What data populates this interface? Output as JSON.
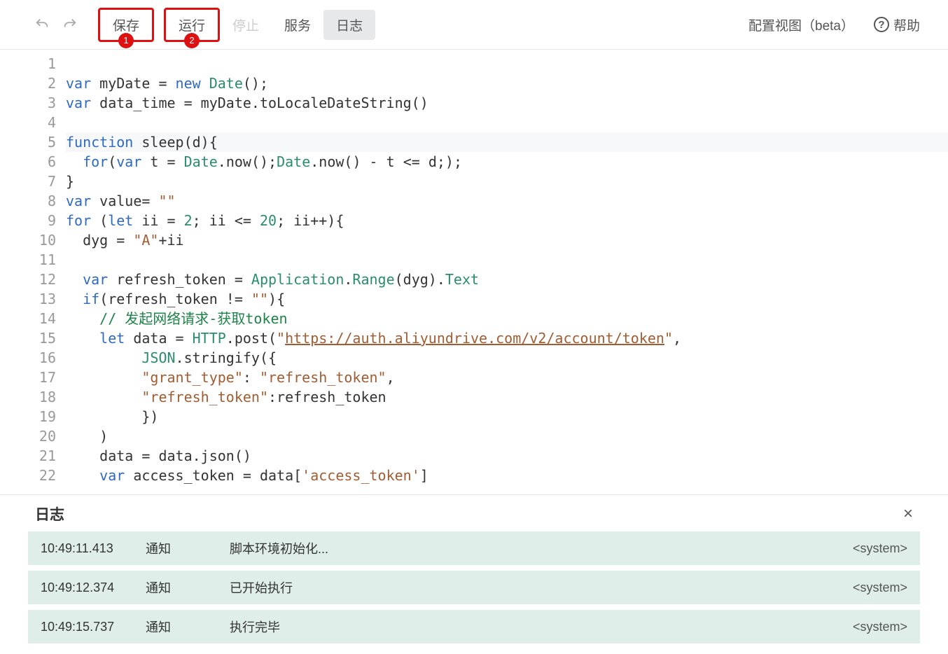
{
  "toolbar": {
    "undo": "undo-icon",
    "redo": "redo-icon",
    "save": "保存",
    "run": "运行",
    "stop": "停止",
    "service": "服务",
    "log": "日志",
    "save_badge": "1",
    "run_badge": "2",
    "config_view": "配置视图（beta）",
    "help": "帮助",
    "help_q": "?"
  },
  "editor": {
    "lines": [
      {
        "n": 1,
        "seg": []
      },
      {
        "n": 2,
        "seg": [
          [
            "kw",
            "var"
          ],
          [
            "",
            " myDate = "
          ],
          [
            "kw",
            "new"
          ],
          [
            "",
            " "
          ],
          [
            "cls",
            "Date"
          ],
          [
            "",
            "();"
          ]
        ]
      },
      {
        "n": 3,
        "seg": [
          [
            "kw",
            "var"
          ],
          [
            "",
            " data_time = myDate.toLocaleDateString()"
          ]
        ]
      },
      {
        "n": 4,
        "seg": []
      },
      {
        "n": 5,
        "seg": [
          [
            "kw",
            "function"
          ],
          [
            "",
            " sleep(d){"
          ]
        ]
      },
      {
        "n": 6,
        "seg": [
          [
            "",
            "  "
          ],
          [
            "kw",
            "for"
          ],
          [
            "",
            "("
          ],
          [
            "kw",
            "var"
          ],
          [
            "",
            " t = "
          ],
          [
            "cls",
            "Date"
          ],
          [
            "",
            ".now();"
          ],
          [
            "cls",
            "Date"
          ],
          [
            "",
            ".now() - t <= d;);"
          ]
        ]
      },
      {
        "n": 7,
        "seg": [
          [
            "",
            "}"
          ]
        ]
      },
      {
        "n": 8,
        "seg": [
          [
            "kw",
            "var"
          ],
          [
            "",
            " value= "
          ],
          [
            "str",
            "\"\""
          ]
        ]
      },
      {
        "n": 9,
        "seg": [
          [
            "kw",
            "for"
          ],
          [
            "",
            " ("
          ],
          [
            "kw",
            "let"
          ],
          [
            "",
            " ii = "
          ],
          [
            "num",
            "2"
          ],
          [
            "",
            "; ii <= "
          ],
          [
            "num",
            "20"
          ],
          [
            "",
            "; ii++){"
          ]
        ]
      },
      {
        "n": 10,
        "seg": [
          [
            "",
            "  dyg = "
          ],
          [
            "str",
            "\"A\""
          ],
          [
            "",
            "+ii"
          ]
        ]
      },
      {
        "n": 11,
        "seg": []
      },
      {
        "n": 12,
        "seg": [
          [
            "",
            "  "
          ],
          [
            "kw",
            "var"
          ],
          [
            "",
            " refresh_token = "
          ],
          [
            "cls",
            "Application"
          ],
          [
            "",
            "."
          ],
          [
            "cls",
            "Range"
          ],
          [
            "",
            "(dyg)."
          ],
          [
            "cls",
            "Text"
          ]
        ]
      },
      {
        "n": 13,
        "seg": [
          [
            "",
            "  "
          ],
          [
            "kw",
            "if"
          ],
          [
            "",
            "(refresh_token != "
          ],
          [
            "str",
            "\"\""
          ],
          [
            "",
            ")"
          ],
          [
            "",
            "{"
          ]
        ]
      },
      {
        "n": 14,
        "seg": [
          [
            "",
            "    "
          ],
          [
            "com",
            "// 发起网络请求-获取token"
          ]
        ]
      },
      {
        "n": 15,
        "seg": [
          [
            "",
            "    "
          ],
          [
            "kw",
            "let"
          ],
          [
            "",
            " data = "
          ],
          [
            "cls",
            "HTTP"
          ],
          [
            "",
            ".post("
          ],
          [
            "str",
            "\""
          ],
          [
            "url",
            "https://auth.aliyundrive.com/v2/account/token"
          ],
          [
            "str",
            "\""
          ],
          [
            "",
            ","
          ]
        ]
      },
      {
        "n": 16,
        "seg": [
          [
            "",
            "         "
          ],
          [
            "cls",
            "JSON"
          ],
          [
            "",
            ".stringify({"
          ]
        ]
      },
      {
        "n": 17,
        "seg": [
          [
            "",
            "         "
          ],
          [
            "str",
            "\"grant_type\""
          ],
          [
            "",
            ": "
          ],
          [
            "str",
            "\"refresh_token\""
          ],
          [
            "",
            ","
          ]
        ]
      },
      {
        "n": 18,
        "seg": [
          [
            "",
            "         "
          ],
          [
            "str",
            "\"refresh_token\""
          ],
          [
            "",
            ":refresh_token"
          ]
        ]
      },
      {
        "n": 19,
        "seg": [
          [
            "",
            "         })"
          ]
        ]
      },
      {
        "n": 20,
        "seg": [
          [
            "",
            "    )"
          ]
        ]
      },
      {
        "n": 21,
        "seg": [
          [
            "",
            "    data = data.json()"
          ]
        ]
      },
      {
        "n": 22,
        "seg": [
          [
            "",
            "    "
          ],
          [
            "kw",
            "var"
          ],
          [
            "",
            " access_token = data["
          ],
          [
            "str",
            "'access_token'"
          ],
          [
            "",
            "]"
          ]
        ]
      }
    ]
  },
  "logpanel": {
    "title": "日志",
    "close": "×",
    "rows": [
      {
        "time": "10:49:11.413",
        "type": "通知",
        "msg": "脚本环境初始化...",
        "src": "<system>"
      },
      {
        "time": "10:49:12.374",
        "type": "通知",
        "msg": "已开始执行",
        "src": "<system>"
      },
      {
        "time": "10:49:15.737",
        "type": "通知",
        "msg": "执行完毕",
        "src": "<system>"
      }
    ]
  }
}
